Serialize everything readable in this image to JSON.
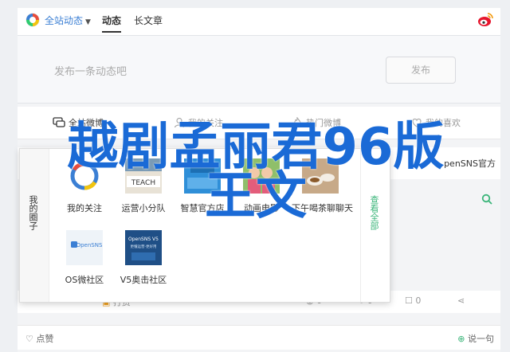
{
  "topnav": {
    "site_label": "全站动态",
    "tabs": [
      "动态",
      "长文章"
    ]
  },
  "composer": {
    "placeholder": "发布一条动态吧",
    "publish_label": "发布"
  },
  "filters": [
    "全站微博",
    "我的关注",
    "热门微博",
    "我的喜欢"
  ],
  "row2": {
    "right_text": "penSNS官方"
  },
  "popup": {
    "left_label": "我的圈子",
    "right_label": "查看全部",
    "tiles": [
      {
        "label": "我的关注"
      },
      {
        "label": "运营小分队"
      },
      {
        "label": "智慧官方店"
      },
      {
        "label": "动画电影"
      },
      {
        "label": "下午喝茶聊聊天"
      },
      {
        "label": "OS微社区"
      },
      {
        "label": "V5奥击社区"
      }
    ],
    "tile_texts": {
      "opensns": "OpenSNS",
      "v5_title": "OpenSNS V5",
      "v5_sub": "更懂运营·更好用",
      "teach": "TEACH"
    }
  },
  "actions": {
    "items": [
      "打赏",
      "0",
      "0",
      "0"
    ]
  },
  "footer": {
    "like_label": "点赞",
    "say_label": "说一句"
  },
  "overlay": {
    "line1": "越剧孟丽君96版",
    "line2": "王文"
  },
  "colors": {
    "brand_blue": "#3b7fd4",
    "accent_green": "#3bb57a",
    "headline_blue": "#1a6ad6"
  }
}
